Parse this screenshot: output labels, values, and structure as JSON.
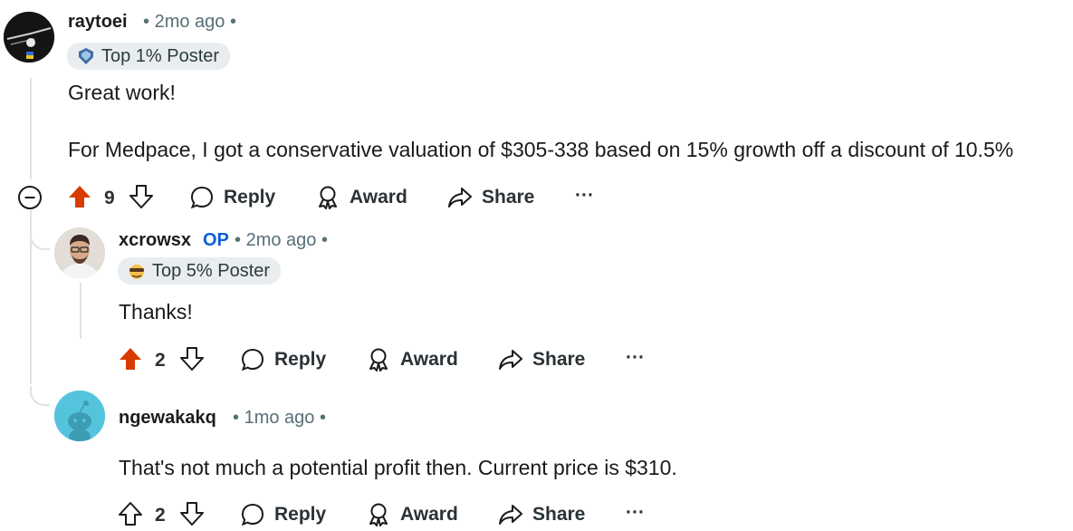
{
  "comments": [
    {
      "username": "raytoei",
      "time": "2mo ago",
      "flair": "Top 1% Poster",
      "body_lines": [
        "Great work!",
        "For Medpace, I got a conservative valuation of $305-338 based on 15% growth off a discount of 10.5%"
      ],
      "votes": "9",
      "upvoted": true
    },
    {
      "username": "xcrowsx",
      "op_label": "OP",
      "time": "2mo ago",
      "flair": "Top 5% Poster",
      "body_lines": [
        "Thanks!"
      ],
      "votes": "2",
      "upvoted": true
    },
    {
      "username": "ngewakakq",
      "time": "1mo ago",
      "body_lines": [
        "That's not much a potential profit then. Current price is $310."
      ],
      "votes": "2",
      "upvoted": false
    }
  ],
  "actions": {
    "reply": "Reply",
    "award": "Award",
    "share": "Share",
    "more": "···"
  },
  "separator": "•",
  "colors": {
    "upvote_active": "#d93a00",
    "op": "#0a5fd6",
    "meta": "#576f76",
    "thread_line": "#dfe3e6",
    "flair_bg": "#eaedef"
  }
}
